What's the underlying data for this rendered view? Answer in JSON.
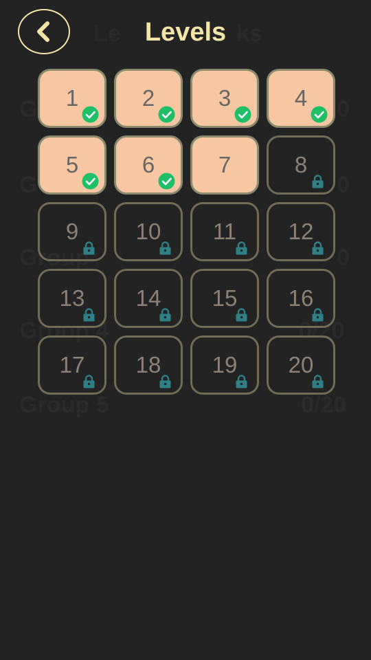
{
  "header": {
    "title": "Levels"
  },
  "levels": [
    {
      "number": "1",
      "state": "completed"
    },
    {
      "number": "2",
      "state": "completed"
    },
    {
      "number": "3",
      "state": "completed"
    },
    {
      "number": "4",
      "state": "completed"
    },
    {
      "number": "5",
      "state": "completed"
    },
    {
      "number": "6",
      "state": "completed"
    },
    {
      "number": "7",
      "state": "unlocked"
    },
    {
      "number": "8",
      "state": "locked"
    },
    {
      "number": "9",
      "state": "locked"
    },
    {
      "number": "10",
      "state": "locked"
    },
    {
      "number": "11",
      "state": "locked"
    },
    {
      "number": "12",
      "state": "locked"
    },
    {
      "number": "13",
      "state": "locked"
    },
    {
      "number": "14",
      "state": "locked"
    },
    {
      "number": "15",
      "state": "locked"
    },
    {
      "number": "16",
      "state": "locked"
    },
    {
      "number": "17",
      "state": "locked"
    },
    {
      "number": "18",
      "state": "locked"
    },
    {
      "number": "19",
      "state": "locked"
    },
    {
      "number": "20",
      "state": "locked"
    }
  ],
  "colors": {
    "title": "#f3e6a8",
    "unlocked_tile": "#f6c7a2",
    "check_badge": "#1fbf6a",
    "lock_icon": "#2f7f86"
  },
  "icons": {
    "back": "chevron-left-icon",
    "completed": "check-icon",
    "locked": "lock-icon"
  }
}
